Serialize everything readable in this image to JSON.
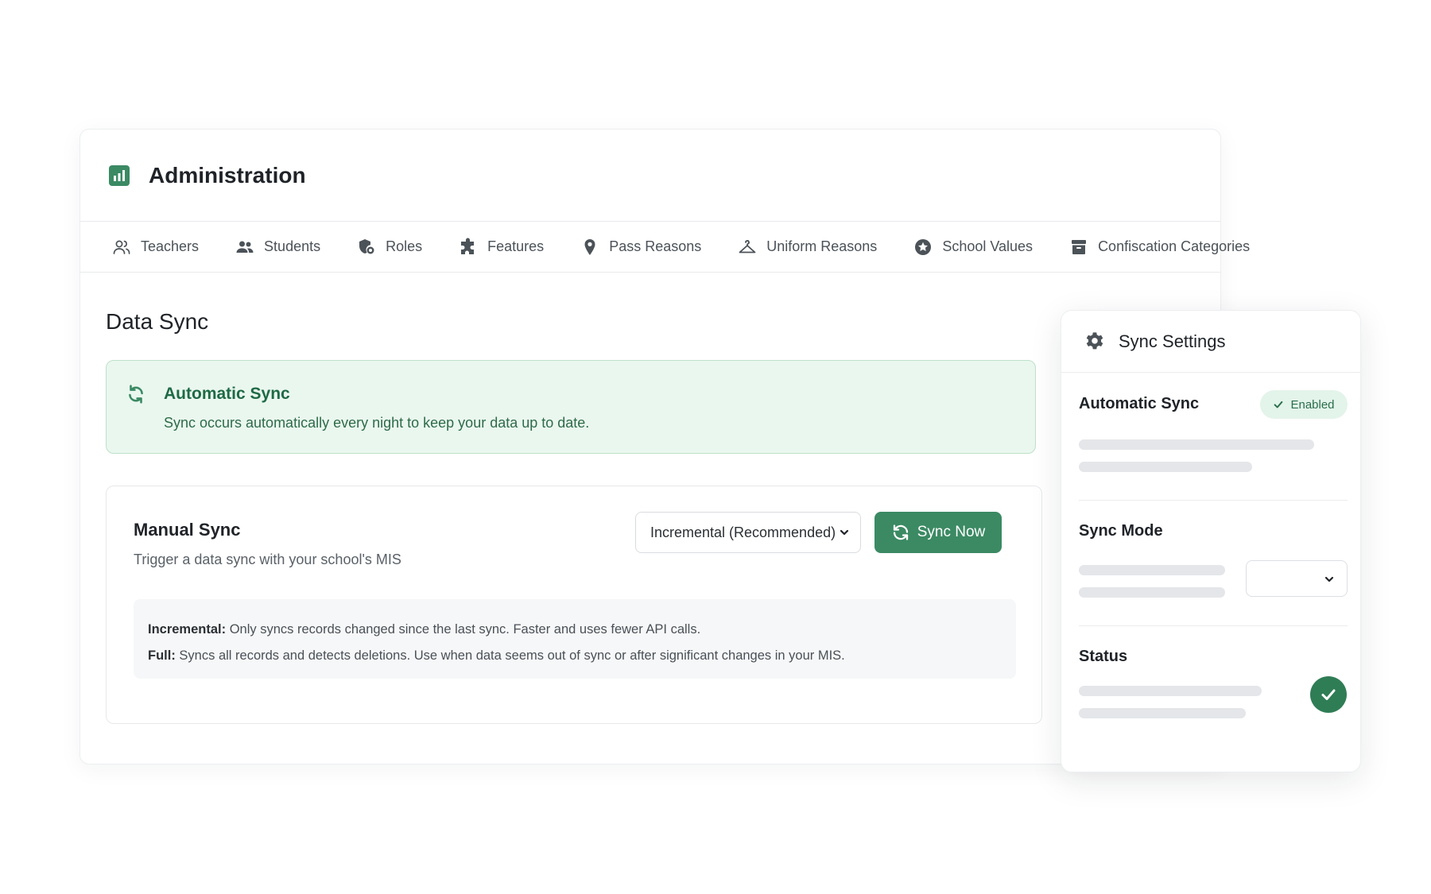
{
  "header": {
    "title": "Administration"
  },
  "nav": {
    "tabs": [
      {
        "label": "Teachers",
        "icon": "users-outline-icon"
      },
      {
        "label": "Students",
        "icon": "users-filled-icon"
      },
      {
        "label": "Roles",
        "icon": "shield-icon"
      },
      {
        "label": "Features",
        "icon": "puzzle-icon"
      },
      {
        "label": "Pass Reasons",
        "icon": "map-pin-icon"
      },
      {
        "label": "Uniform Reasons",
        "icon": "hanger-icon"
      },
      {
        "label": "School Values",
        "icon": "star-badge-icon"
      },
      {
        "label": "Confiscation Categories",
        "icon": "archive-icon"
      }
    ]
  },
  "data_sync": {
    "title": "Data Sync",
    "auto": {
      "title": "Automatic Sync",
      "description": "Sync occurs automatically every night to keep your data up to date."
    },
    "manual": {
      "title": "Manual Sync",
      "description": "Trigger a data sync with your school's MIS",
      "mode_selected": "Incremental (Recommended)",
      "button_label": "Sync Now",
      "info": {
        "incremental_label": "Incremental:",
        "incremental_text": "Only syncs records changed since the last sync. Faster and uses fewer API calls.",
        "full_label": "Full:",
        "full_text": "Syncs all records and detects deletions. Use when data seems out of sync or after significant changes in your MIS."
      }
    }
  },
  "settings_panel": {
    "title": "Sync Settings",
    "automatic_sync_label": "Automatic Sync",
    "enabled_badge": "Enabled",
    "sync_mode_label": "Sync Mode",
    "status_label": "Status"
  },
  "colors": {
    "brand_green": "#3b8a63",
    "banner_bg": "#eaf7ef",
    "banner_border": "#bde2ca",
    "banner_title": "#1e6a45",
    "badge_bg": "#e3f4ea",
    "status_ok": "#2f7d55"
  }
}
